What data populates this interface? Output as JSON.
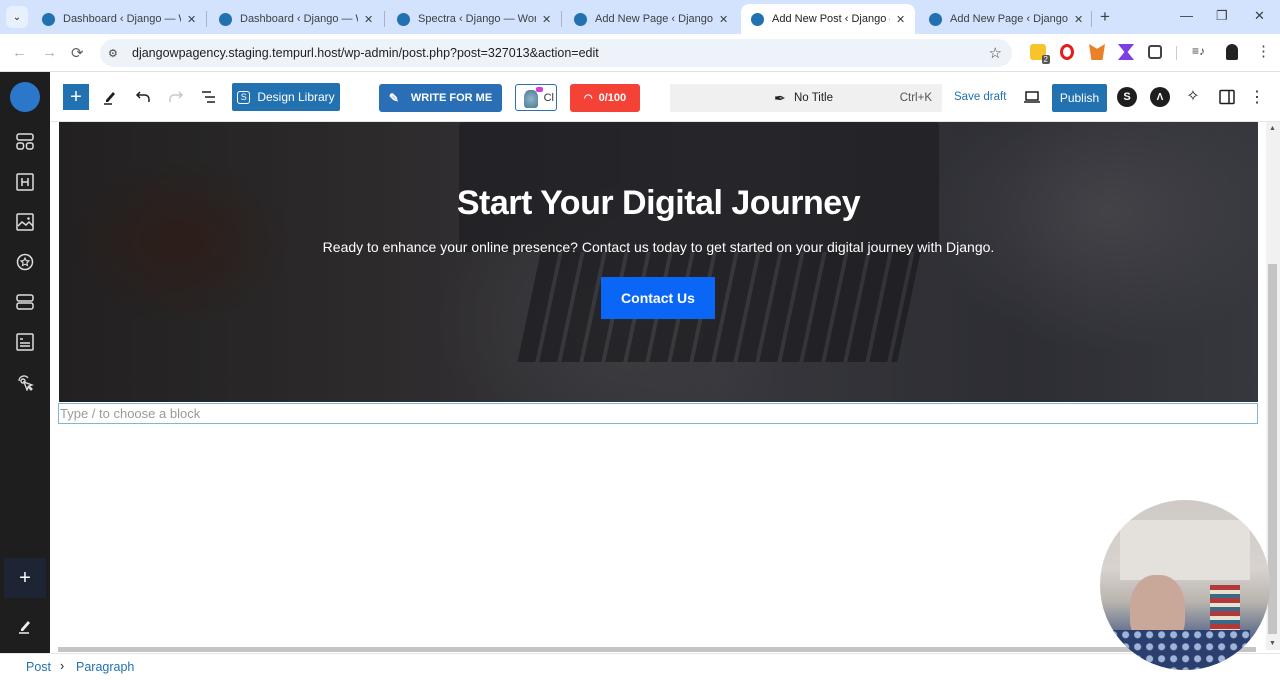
{
  "browser": {
    "tabs": [
      {
        "title": "Dashboard ‹ Django — W",
        "active": false
      },
      {
        "title": "Dashboard ‹ Django — W",
        "active": false
      },
      {
        "title": "Spectra ‹ Django — WordP",
        "active": false
      },
      {
        "title": "Add New Page ‹ Django —",
        "active": false
      },
      {
        "title": "Add New Post ‹ Django —",
        "active": true
      },
      {
        "title": "Add New Page ‹ Django —",
        "active": false
      }
    ],
    "url": "djangowpagency.staging.tempurl.host/wp-admin/post.php?post=327013&action=edit",
    "extension_badge": "2",
    "icons": {
      "back": "←",
      "forward": "→",
      "reload": "⟳",
      "star": "☆",
      "new_tab": "+",
      "minimize": "—",
      "restore": "❐",
      "close": "✕",
      "tab_close": "✕",
      "tab_search": "⌄",
      "menu": "⋮"
    }
  },
  "editor": {
    "toolbar": {
      "add_block": "+",
      "design_library": "Design Library",
      "write_for_me": "WRITE FOR ME",
      "ai_badge_text": "Cl",
      "seo_score": "0/100",
      "command_title": "No Title",
      "command_shortcut": "Ctrl+K",
      "save_draft": "Save draft",
      "publish": "Publish"
    },
    "hero": {
      "title": "Start Your Digital Journey",
      "subtitle": "Ready to enhance your online presence? Contact us today to get started on your digital journey with Django.",
      "button": "Contact Us"
    },
    "paragraph_placeholder": "Type / to choose a block",
    "breadcrumb": [
      "Post",
      "Paragraph"
    ],
    "breadcrumb_sep": "›",
    "sidebar_plus": "+"
  },
  "colors": {
    "wp_blue": "#2271b1",
    "seo_red": "#f44336",
    "hero_button": "#0a66f5",
    "sidebar_bg": "#1e1e1e"
  }
}
